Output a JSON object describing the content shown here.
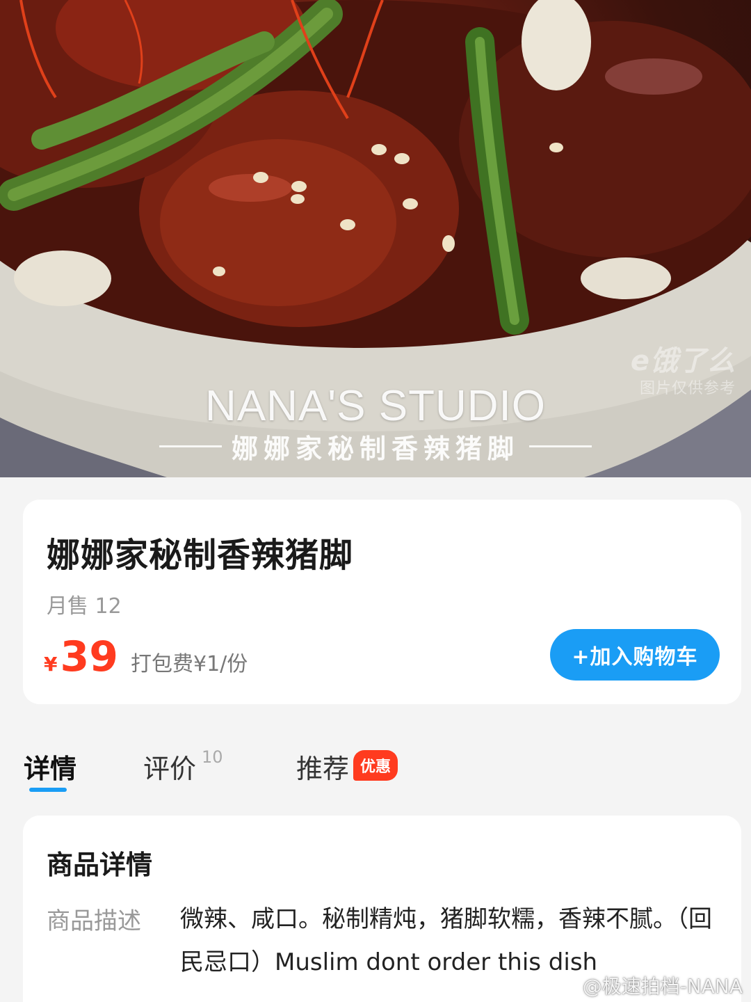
{
  "hero": {
    "brand": "NANA'S STUDIO",
    "subtitle": "娜娜家秘制香辣猪脚",
    "watermark_logo": "e饿了么",
    "watermark_note": "图片仅供参考"
  },
  "product": {
    "title": "娜娜家秘制香辣猪脚",
    "monthly_sales": "月售 12",
    "price_symbol": "¥",
    "price": "39",
    "packing_fee": "打包费¥1/份",
    "add_to_cart": "+加入购物车"
  },
  "tabs": {
    "details": "详情",
    "reviews": "评价",
    "reviews_count": "10",
    "recommend": "推荐",
    "recommend_badge": "优惠"
  },
  "details": {
    "heading": "商品详情",
    "description_label": "商品描述",
    "description": "微辣、咸口。秘制精炖，猪脚软糯，香辣不腻。（回民忌口）Muslim dont order this dish"
  },
  "footer": {
    "watermark": "@极速拍档-NANA"
  },
  "colors": {
    "accent_blue": "#1a9df5",
    "price_red": "#ff3b1f"
  }
}
